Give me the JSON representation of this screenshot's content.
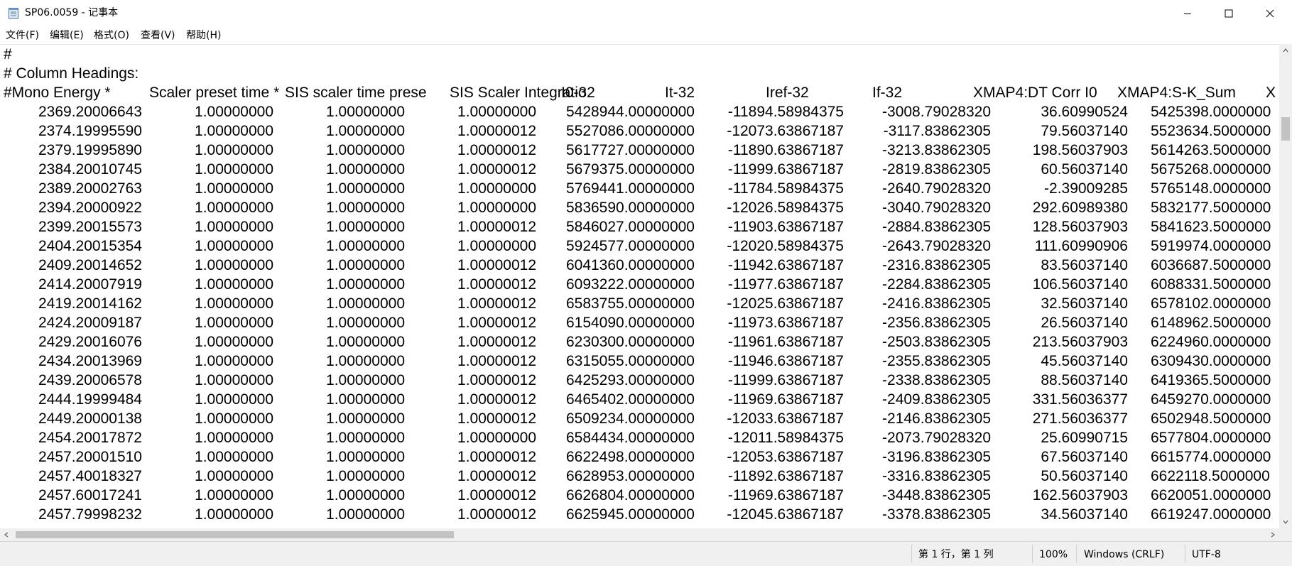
{
  "window": {
    "title": "SP06.0059 - 记事本",
    "icon": "notepad-icon",
    "minimize_icon": "minimize-icon",
    "maximize_icon": "maximize-icon",
    "close_icon": "close-icon"
  },
  "menu": [
    "文件(F)",
    "编辑(E)",
    "格式(O)",
    "查看(V)",
    "帮助(H)"
  ],
  "editor": {
    "line1": "#",
    "line2": "# Column Headings:",
    "headers": [
      "#Mono Energy *",
      "Scaler preset time *",
      "SIS scaler time prese",
      "SIS Scaler Integratio",
      "I0-32",
      "It-32",
      "Iref-32",
      "If-32",
      "XMAP4:DT Corr I0",
      "XMAP4:S-K_Sum",
      "X"
    ],
    "rows": [
      [
        "2369.20006643",
        "1.00000000",
        "1.00000000",
        "1.00000000",
        "5428944.00000000",
        "-11894.58984375",
        "-3008.79028320",
        "36.60990524",
        "5425398.0000000"
      ],
      [
        "2374.19995590",
        "1.00000000",
        "1.00000000",
        "1.00000012",
        "5527086.00000000",
        "-12073.63867187",
        "-3117.83862305",
        "79.56037140",
        "5523634.5000000"
      ],
      [
        "2379.19995890",
        "1.00000000",
        "1.00000000",
        "1.00000012",
        "5617727.00000000",
        "-11890.63867187",
        "-3213.83862305",
        "198.56037903",
        "5614263.5000000"
      ],
      [
        "2384.20010745",
        "1.00000000",
        "1.00000000",
        "1.00000012",
        "5679375.00000000",
        "-11999.63867187",
        "-2819.83862305",
        "60.56037140",
        "5675268.0000000"
      ],
      [
        "2389.20002763",
        "1.00000000",
        "1.00000000",
        "1.00000000",
        "5769441.00000000",
        "-11784.58984375",
        "-2640.79028320",
        "-2.39009285",
        "5765148.0000000"
      ],
      [
        "2394.20000922",
        "1.00000000",
        "1.00000000",
        "1.00000000",
        "5836590.00000000",
        "-12026.58984375",
        "-3040.79028320",
        "292.60989380",
        "5832177.5000000"
      ],
      [
        "2399.20015573",
        "1.00000000",
        "1.00000000",
        "1.00000012",
        "5846027.00000000",
        "-11903.63867187",
        "-2884.83862305",
        "128.56037903",
        "5841623.5000000"
      ],
      [
        "2404.20015354",
        "1.00000000",
        "1.00000000",
        "1.00000000",
        "5924577.00000000",
        "-12020.58984375",
        "-2643.79028320",
        "111.60990906",
        "5919974.0000000"
      ],
      [
        "2409.20014652",
        "1.00000000",
        "1.00000000",
        "1.00000012",
        "6041360.00000000",
        "-11942.63867187",
        "-2316.83862305",
        "83.56037140",
        "6036687.5000000"
      ],
      [
        "2414.20007919",
        "1.00000000",
        "1.00000000",
        "1.00000012",
        "6093222.00000000",
        "-11977.63867187",
        "-2284.83862305",
        "106.56037140",
        "6088331.5000000"
      ],
      [
        "2419.20014162",
        "1.00000000",
        "1.00000000",
        "1.00000012",
        "6583755.00000000",
        "-12025.63867187",
        "-2416.83862305",
        "32.56037140",
        "6578102.0000000"
      ],
      [
        "2424.20009187",
        "1.00000000",
        "1.00000000",
        "1.00000012",
        "6154090.00000000",
        "-11973.63867187",
        "-2356.83862305",
        "26.56037140",
        "6148962.5000000"
      ],
      [
        "2429.20016076",
        "1.00000000",
        "1.00000000",
        "1.00000012",
        "6230300.00000000",
        "-11961.63867187",
        "-2503.83862305",
        "213.56037903",
        "6224960.0000000"
      ],
      [
        "2434.20013969",
        "1.00000000",
        "1.00000000",
        "1.00000012",
        "6315055.00000000",
        "-11946.63867187",
        "-2355.83862305",
        "45.56037140",
        "6309430.0000000"
      ],
      [
        "2439.20006578",
        "1.00000000",
        "1.00000000",
        "1.00000012",
        "6425293.00000000",
        "-11999.63867187",
        "-2338.83862305",
        "88.56037140",
        "6419365.5000000"
      ],
      [
        "2444.19999484",
        "1.00000000",
        "1.00000000",
        "1.00000012",
        "6465402.00000000",
        "-11969.63867187",
        "-2409.83862305",
        "331.56036377",
        "6459270.0000000"
      ],
      [
        "2449.20000138",
        "1.00000000",
        "1.00000000",
        "1.00000012",
        "6509234.00000000",
        "-12033.63867187",
        "-2146.83862305",
        "271.56036377",
        "6502948.5000000"
      ],
      [
        "2454.20017872",
        "1.00000000",
        "1.00000000",
        "1.00000000",
        "6584434.00000000",
        "-12011.58984375",
        "-2073.79028320",
        "25.60990715",
        "6577804.0000000"
      ],
      [
        "2457.20001510",
        "1.00000000",
        "1.00000000",
        "1.00000012",
        "6622498.00000000",
        "-12053.63867187",
        "-3196.83862305",
        "67.56037140",
        "6615774.0000000"
      ],
      [
        "2457.40018327",
        "1.00000000",
        "1.00000000",
        "1.00000012",
        "6628953.00000000",
        "-11892.63867187",
        "-3316.83862305",
        "50.56037140",
        "6622118.5000000"
      ],
      [
        "2457.60017241",
        "1.00000000",
        "1.00000000",
        "1.00000012",
        "6626804.00000000",
        "-11969.63867187",
        "-3448.83862305",
        "162.56037903",
        "6620051.0000000"
      ],
      [
        "2457.79998232",
        "1.00000000",
        "1.00000000",
        "1.00000012",
        "6625945.00000000",
        "-12045.63867187",
        "-3378.83862305",
        "34.56037140",
        "6619247.0000000"
      ]
    ]
  },
  "status": {
    "position": "第 1 行，第 1 列",
    "zoom": "100%",
    "line_ending": "Windows (CRLF)",
    "encoding": "UTF-8"
  }
}
